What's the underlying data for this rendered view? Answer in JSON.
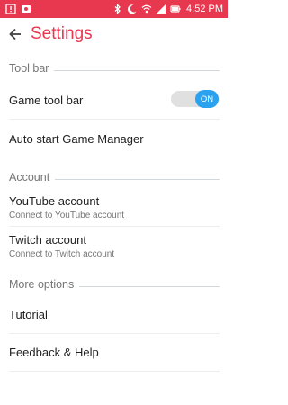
{
  "status_bar": {
    "time": "4:52 PM",
    "left_icons": [
      "alert-icon",
      "photo-icon"
    ],
    "right_icons": [
      "bluetooth-icon",
      "moon-icon",
      "wifi-icon",
      "signal-icon",
      "battery-icon"
    ]
  },
  "header": {
    "title": "Settings",
    "back_icon": "back-arrow-icon"
  },
  "sections": {
    "toolbar": {
      "header": "Tool bar",
      "game_tool_bar": {
        "label": "Game tool bar",
        "toggle": "ON",
        "enabled": true
      },
      "auto_start": {
        "label": "Auto start Game Manager"
      }
    },
    "account": {
      "header": "Account",
      "youtube": {
        "title": "YouTube account",
        "subtitle": "Connect to YouTube account"
      },
      "twitch": {
        "title": "Twitch account",
        "subtitle": "Connect to Twitch account"
      }
    },
    "more_options": {
      "header": "More options",
      "tutorial": {
        "label": "Tutorial"
      },
      "feedback": {
        "label": "Feedback & Help"
      }
    }
  },
  "colors": {
    "accent": "#e8384f",
    "toggle_on": "#2aa2f0"
  }
}
